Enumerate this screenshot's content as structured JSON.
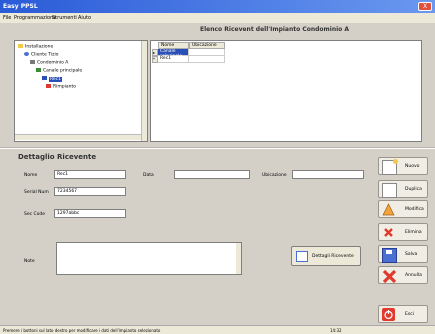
{
  "window": {
    "title": "Easy PPSL",
    "control_label": "X"
  },
  "menu": [
    "File",
    "Programmazione",
    "Strumenti",
    "Aiuto"
  ],
  "heading": "Elenco Ricevent dell'Impianto Condominio A",
  "tree": [
    {
      "label": "Installazione",
      "icon": "folder-icon"
    },
    {
      "label": "Cliente Tizio",
      "icon": "person-icon"
    },
    {
      "label": "Condominio A",
      "icon": "building-icon"
    },
    {
      "label": "Canale principale",
      "icon": "channel-icon"
    },
    {
      "label": "Rec1",
      "icon": "receiver-icon",
      "selected": true
    },
    {
      "label": "Rimpianto",
      "icon": "calendar-icon"
    }
  ],
  "grid": {
    "headers": [
      "Nome",
      "Ubicazione"
    ],
    "rows": [
      {
        "marker": "▸",
        "cells": [
          "Canale principale",
          ""
        ],
        "selected": true
      },
      {
        "marker": "*",
        "cells": [
          "Rec1",
          ""
        ]
      }
    ]
  },
  "detail": {
    "title": "Dettaglio Ricevente",
    "nome_label": "Nome",
    "nome_value": "Rec1",
    "data_label": "Data",
    "data_value": "",
    "ubicazione_label": "Ubicazione",
    "ubicazione_value": "",
    "serial_label": "Serial Num",
    "serial_value": "7234567",
    "seccode_label": "Sec Code",
    "sec_code_value": "1297abbc",
    "note_label": "Note",
    "note_value": "",
    "dettagli_button": "Dettagli Ricevente"
  },
  "side_buttons": [
    {
      "label": "Nuovo",
      "icon": "new-document-icon",
      "color": "#f2c94c"
    },
    {
      "label": "Duplica",
      "icon": "duplicate-icon",
      "color": "#f2c94c"
    },
    {
      "label": "Modifica",
      "icon": "warning-icon",
      "color": "#f2a33a"
    },
    {
      "label": "Elimina",
      "icon": "delete-icon",
      "color": "#e03a2e"
    },
    {
      "label": "Salva",
      "icon": "save-icon",
      "color": "#4a6fd3"
    },
    {
      "label": "Annulla",
      "icon": "cancel-icon",
      "color": "#e03a2e"
    }
  ],
  "exit_button": {
    "label": "Esci",
    "icon": "power-icon",
    "color": "#e03a2e"
  },
  "statusbar": {
    "left": "Premere i bottoni sul lato destro per modificare i dati dell'impianto selezionato",
    "right": "14:32"
  }
}
